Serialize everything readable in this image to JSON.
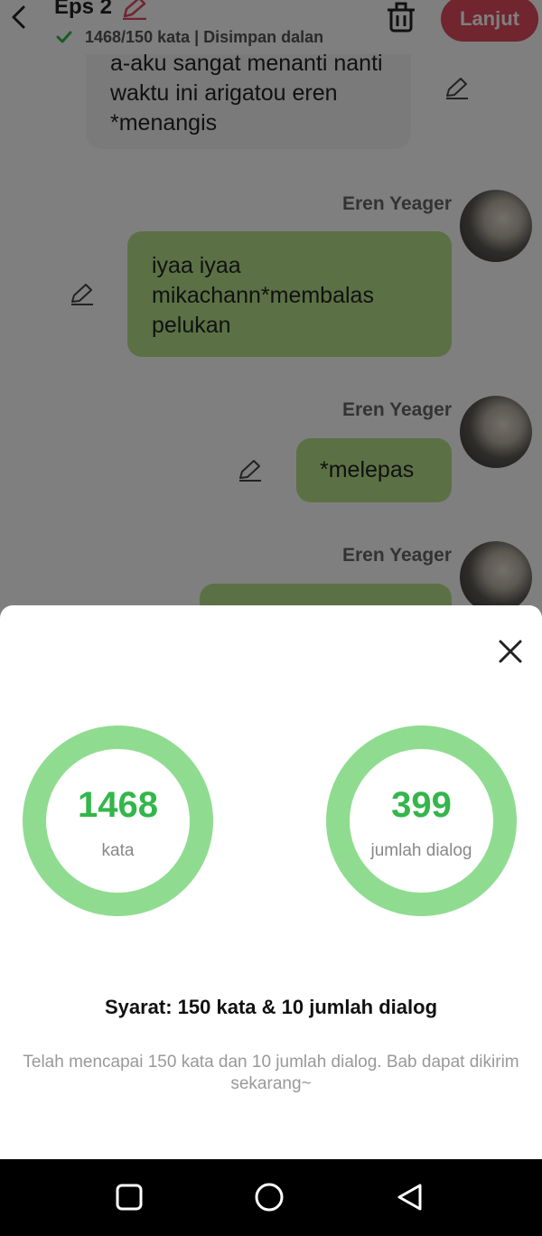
{
  "header": {
    "title": "Eps 2",
    "save_status": "1468/150 kata | Disimpan dalan",
    "next_label": "Lanjut"
  },
  "chat": {
    "top_bubble_text": "a-aku sangat menanti nanti waktu ini arigatou eren *menangis",
    "messages": [
      {
        "speaker": "Eren Yeager",
        "text": "iyaa iyaa mikachann*membalas pelukan"
      },
      {
        "speaker": "Eren Yeager",
        "text": "*melepas"
      },
      {
        "speaker": "Eren Yeager",
        "text": ""
      }
    ]
  },
  "stats": {
    "words": {
      "value": "1468",
      "label": "kata"
    },
    "dialogs": {
      "value": "399",
      "label": "jumlah dialog"
    }
  },
  "requirement": {
    "title": "Syarat: 150 kata & 10 jumlah dialog",
    "note": "Telah mencapai 150 kata dan 10 jumlah dialog. Bab dapat dikirim sekarang~"
  },
  "colors": {
    "accent_red": "#e04a5e",
    "ring_green": "#8fdc90",
    "value_green": "#33b64a",
    "bubble_green": "#b6e38a"
  },
  "icons": {
    "back": "chevron-left-icon",
    "edit": "pencil-icon",
    "trash": "trash-icon",
    "close": "close-icon",
    "nav_recents": "square-icon",
    "nav_home": "circle-icon",
    "nav_back": "triangle-icon"
  }
}
